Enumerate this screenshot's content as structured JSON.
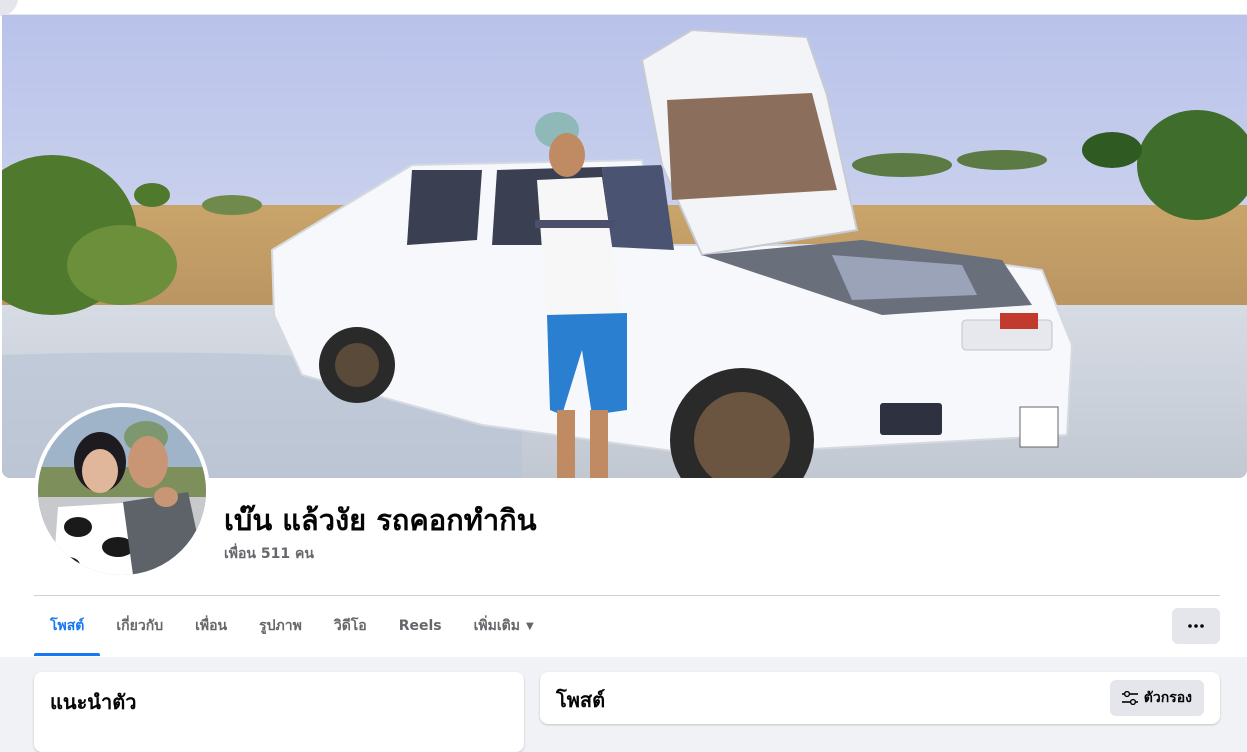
{
  "profile": {
    "name": "เบ๊น แล้วงัย รถคอกทำกิน",
    "friends_count": "เพื่อน 511 คน"
  },
  "tabs": [
    {
      "label": "โพสต์",
      "active": true
    },
    {
      "label": "เกี่ยวกับ"
    },
    {
      "label": "เพื่อน"
    },
    {
      "label": "รูปภาพ"
    },
    {
      "label": "วิดีโอ"
    },
    {
      "label": "Reels"
    },
    {
      "label": "เพิ่มเติม",
      "icon": "caret-down-icon"
    }
  ],
  "more_menu": {
    "icon": "more-dots-icon",
    "glyph": "•••"
  },
  "intro": {
    "title": "แนะนำตัว"
  },
  "posts": {
    "title": "โพสต์",
    "filter_label": "ตัวกรอง",
    "filter_icon": "sliders-icon"
  },
  "colors": {
    "accent": "#1877f2",
    "background": "#f0f2f5",
    "button_gray": "#e4e6eb",
    "secondary_text": "#65676b"
  }
}
